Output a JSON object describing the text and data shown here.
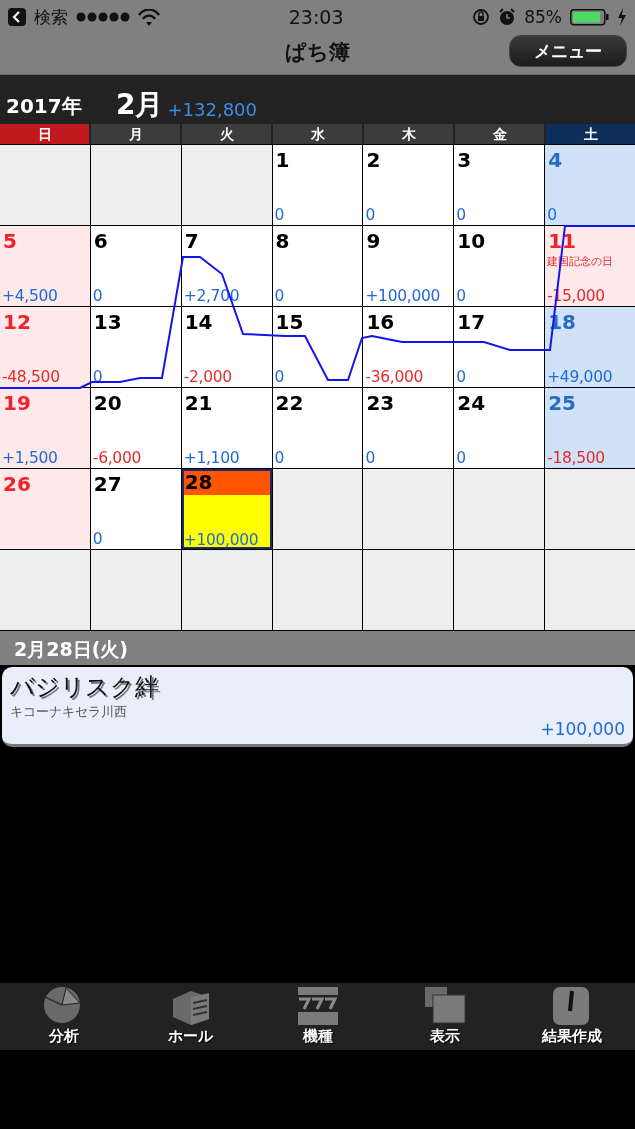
{
  "status_bar": {
    "back_label": "検索",
    "time": "23:03",
    "battery": "85%"
  },
  "nav": {
    "title": "ぱち簿",
    "menu_button": "メニュー"
  },
  "month_header": {
    "year": "2017年",
    "month": "2月",
    "total": "+132,800"
  },
  "weekdays": [
    {
      "label": "日",
      "kind": "sun"
    },
    {
      "label": "月",
      "kind": "weekday"
    },
    {
      "label": "火",
      "kind": "weekday"
    },
    {
      "label": "水",
      "kind": "weekday"
    },
    {
      "label": "木",
      "kind": "weekday"
    },
    {
      "label": "金",
      "kind": "weekday"
    },
    {
      "label": "土",
      "kind": "sat"
    }
  ],
  "weeks": [
    [
      {
        "kind": "blank"
      },
      {
        "kind": "blank"
      },
      {
        "kind": "blank"
      },
      {
        "kind": "weekday",
        "day": "1",
        "amount": "0",
        "loss": false,
        "selected": false
      },
      {
        "kind": "weekday",
        "day": "2",
        "amount": "0",
        "loss": false,
        "selected": false
      },
      {
        "kind": "weekday",
        "day": "3",
        "amount": "0",
        "loss": false,
        "selected": false
      },
      {
        "kind": "sat",
        "day": "4",
        "amount": "0",
        "loss": false,
        "selected": false
      }
    ],
    [
      {
        "kind": "sun",
        "day": "5",
        "amount": "+4,500",
        "loss": false,
        "selected": false
      },
      {
        "kind": "weekday",
        "day": "6",
        "amount": "0",
        "loss": false,
        "selected": false
      },
      {
        "kind": "weekday",
        "day": "7",
        "amount": "+2,700",
        "loss": false,
        "selected": false
      },
      {
        "kind": "weekday",
        "day": "8",
        "amount": "0",
        "loss": false,
        "selected": false
      },
      {
        "kind": "weekday",
        "day": "9",
        "amount": "+100,000",
        "loss": false,
        "selected": false
      },
      {
        "kind": "weekday",
        "day": "10",
        "amount": "0",
        "loss": false,
        "selected": false
      },
      {
        "kind": "holiday",
        "day": "11",
        "holiday": "建国記念の日",
        "amount": "-15,000",
        "loss": true,
        "selected": false
      }
    ],
    [
      {
        "kind": "sun",
        "day": "12",
        "amount": "-48,500",
        "loss": true,
        "selected": false
      },
      {
        "kind": "weekday",
        "day": "13",
        "amount": "0",
        "loss": false,
        "selected": false
      },
      {
        "kind": "weekday",
        "day": "14",
        "amount": "-2,000",
        "loss": true,
        "selected": false
      },
      {
        "kind": "weekday",
        "day": "15",
        "amount": "0",
        "loss": false,
        "selected": false
      },
      {
        "kind": "weekday",
        "day": "16",
        "amount": "-36,000",
        "loss": true,
        "selected": false
      },
      {
        "kind": "weekday",
        "day": "17",
        "amount": "0",
        "loss": false,
        "selected": false
      },
      {
        "kind": "sat",
        "day": "18",
        "amount": "+49,000",
        "loss": false,
        "selected": false
      }
    ],
    [
      {
        "kind": "sun",
        "day": "19",
        "amount": "+1,500",
        "loss": false,
        "selected": false
      },
      {
        "kind": "weekday",
        "day": "20",
        "amount": "-6,000",
        "loss": true,
        "selected": false
      },
      {
        "kind": "weekday",
        "day": "21",
        "amount": "+1,100",
        "loss": false,
        "selected": false
      },
      {
        "kind": "weekday",
        "day": "22",
        "amount": "0",
        "loss": false,
        "selected": false
      },
      {
        "kind": "weekday",
        "day": "23",
        "amount": "0",
        "loss": false,
        "selected": false
      },
      {
        "kind": "weekday",
        "day": "24",
        "amount": "0",
        "loss": false,
        "selected": false
      },
      {
        "kind": "sat",
        "day": "25",
        "amount": "-18,500",
        "loss": true,
        "selected": false
      }
    ],
    [
      {
        "kind": "sun",
        "day": "26",
        "selected": false
      },
      {
        "kind": "weekday",
        "day": "27",
        "amount": "0",
        "loss": false,
        "selected": false
      },
      {
        "kind": "weekday",
        "day": "28",
        "amount": "+100,000",
        "loss": false,
        "selected": true
      },
      {
        "kind": "blank"
      },
      {
        "kind": "blank"
      },
      {
        "kind": "blank"
      },
      {
        "kind": "blank"
      }
    ],
    [
      {
        "kind": "blank"
      },
      {
        "kind": "blank"
      },
      {
        "kind": "blank"
      },
      {
        "kind": "blank"
      },
      {
        "kind": "blank"
      },
      {
        "kind": "blank"
      },
      {
        "kind": "blank"
      }
    ]
  ],
  "detail": {
    "date_label": "2月28日(火)",
    "entries": [
      {
        "machine": "バジリスク絆",
        "hall": "キコーナキセラ川西",
        "amount": "+100,000",
        "loss": false
      }
    ]
  },
  "tab_bar": [
    {
      "label": "分析"
    },
    {
      "label": "ホール"
    },
    {
      "label": "機種"
    },
    {
      "label": "表示"
    },
    {
      "label": "結果作成"
    }
  ]
}
